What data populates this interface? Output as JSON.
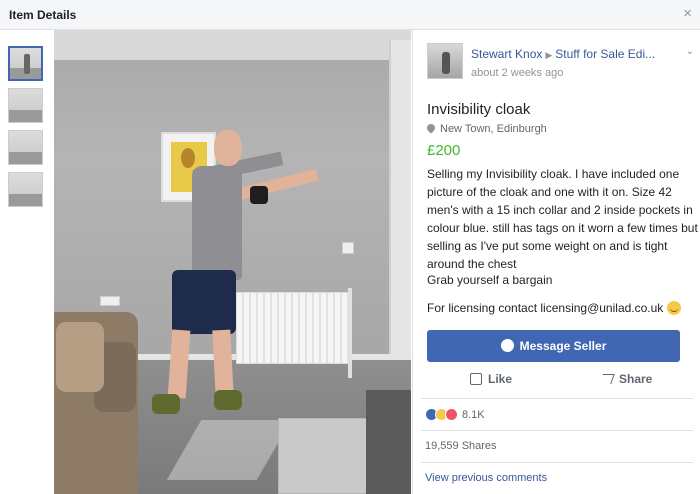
{
  "window": {
    "title": "Item Details",
    "close_label": "×"
  },
  "post": {
    "author": "Stewart Knox",
    "separator": "▶",
    "group": "Stuff for Sale Edi...",
    "time": "about 2 weeks ago",
    "menu_glyph": "⌄"
  },
  "item": {
    "title": "Invisibility cloak",
    "location": "New Town, Edinburgh",
    "price": "£200",
    "description": "Selling my Invisibility cloak. I have included one picture of the cloak and one with it on. Size 42 men's with a 15 inch collar and 2 inside pockets in colour blue. still has tags on it worn a few times but selling as I've put some weight on and is tight around the chest",
    "extra": "Grab yourself a bargain",
    "licensing": "For licensing contact licensing@unilad.co.uk"
  },
  "actions": {
    "message_seller": "Message Seller",
    "like": "Like",
    "share": "Share"
  },
  "stats": {
    "reactions": "8.1K",
    "shares": "19,559 Shares",
    "view_comments": "View previous comments"
  },
  "thumbnails": [
    "photo-1",
    "photo-2",
    "photo-3",
    "photo-4"
  ],
  "colors": {
    "brand": "#4267b2",
    "price": "#42b72a",
    "link": "#365899"
  }
}
